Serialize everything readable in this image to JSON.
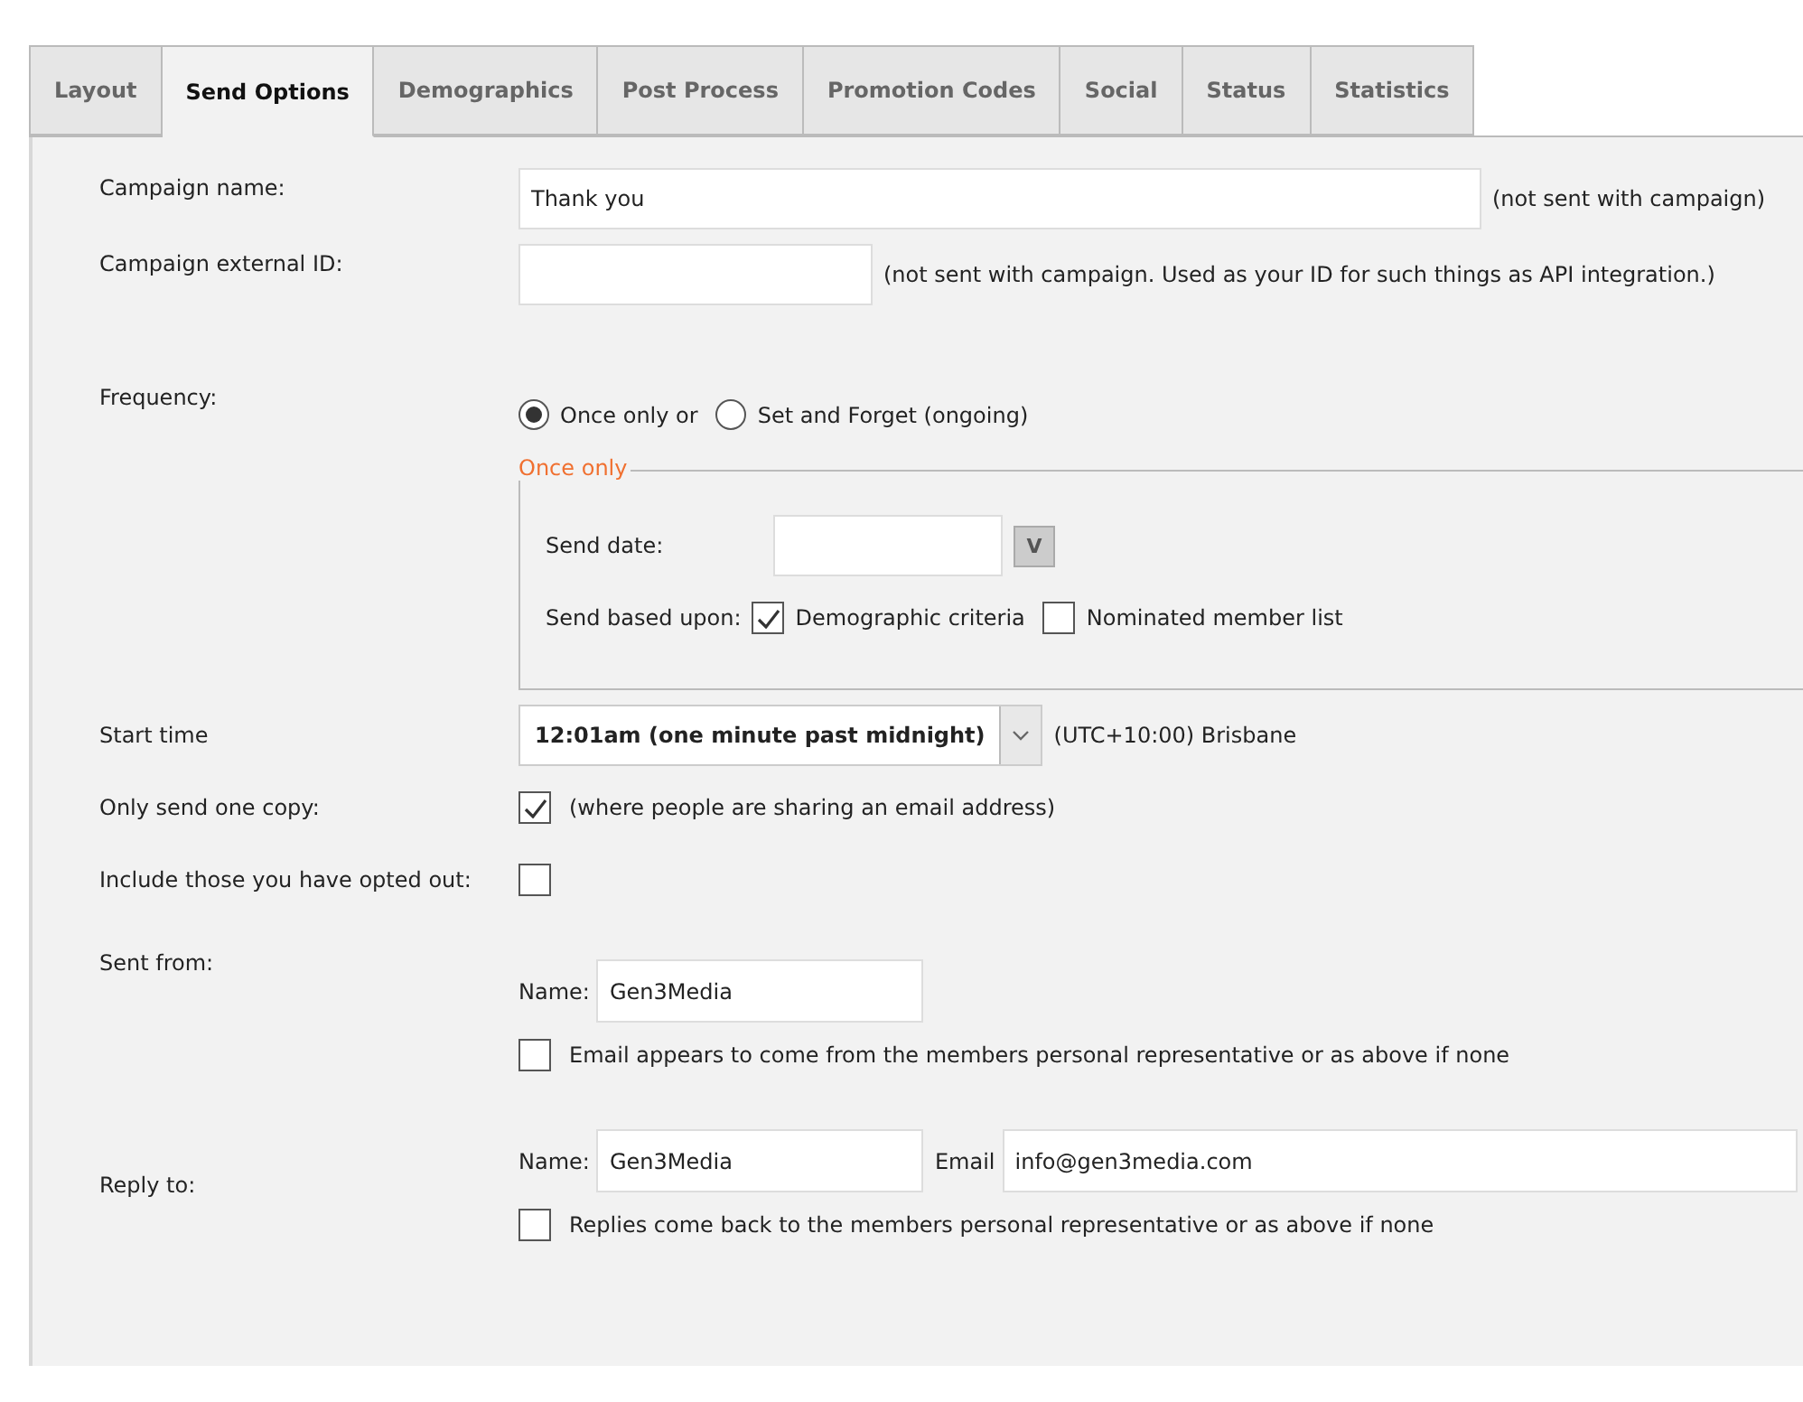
{
  "tabs": [
    {
      "label": "Layout",
      "selected": false
    },
    {
      "label": "Send Options",
      "selected": true
    },
    {
      "label": "Demographics",
      "selected": false
    },
    {
      "label": "Post Process",
      "selected": false
    },
    {
      "label": "Promotion Codes",
      "selected": false
    },
    {
      "label": "Social",
      "selected": false
    },
    {
      "label": "Status",
      "selected": false
    },
    {
      "label": "Statistics",
      "selected": false
    }
  ],
  "campaign_name": {
    "label": "Campaign name:",
    "value": "Thank you",
    "note": "(not sent with campaign)"
  },
  "campaign_external_id": {
    "label": "Campaign external ID:",
    "note": "(not sent with campaign. Used as your ID for such things as API integration.)"
  },
  "frequency": {
    "label": "Frequency:",
    "options": [
      {
        "label": "Once only or",
        "selected": true
      },
      {
        "label": "Set and Forget (ongoing)",
        "selected": false
      }
    ]
  },
  "once_only": {
    "legend": "Once only",
    "send_date_label": "Send date:",
    "date_button": "V",
    "send_based_label": "Send based upon:",
    "criteria": [
      {
        "label": "Demographic criteria",
        "checked": true
      },
      {
        "label": "Nominated member list",
        "checked": false
      }
    ]
  },
  "start_time": {
    "label": "Start time",
    "value": "12:01am (one minute past midnight)",
    "timezone": "(UTC+10:00) Brisbane"
  },
  "only_send_one_copy": {
    "label": "Only send one copy:",
    "checked": true,
    "note": "(where people are sharing an email address)"
  },
  "include_opted_out": {
    "label": "Include those you have opted out:",
    "checked": false
  },
  "sent_from": {
    "label": "Sent from:",
    "name_label": "Name:",
    "name_value": "Gen3Media",
    "rep_checked": false,
    "rep_label": "Email appears to come from the members personal representative or as above if none"
  },
  "reply_to": {
    "label": "Reply to:",
    "name_label": "Name:",
    "name_value": "Gen3Media",
    "email_label": "Email",
    "email_value": "info@gen3media.com",
    "rep_checked": false,
    "rep_label": "Replies come back to the members personal representative or as above if none"
  }
}
